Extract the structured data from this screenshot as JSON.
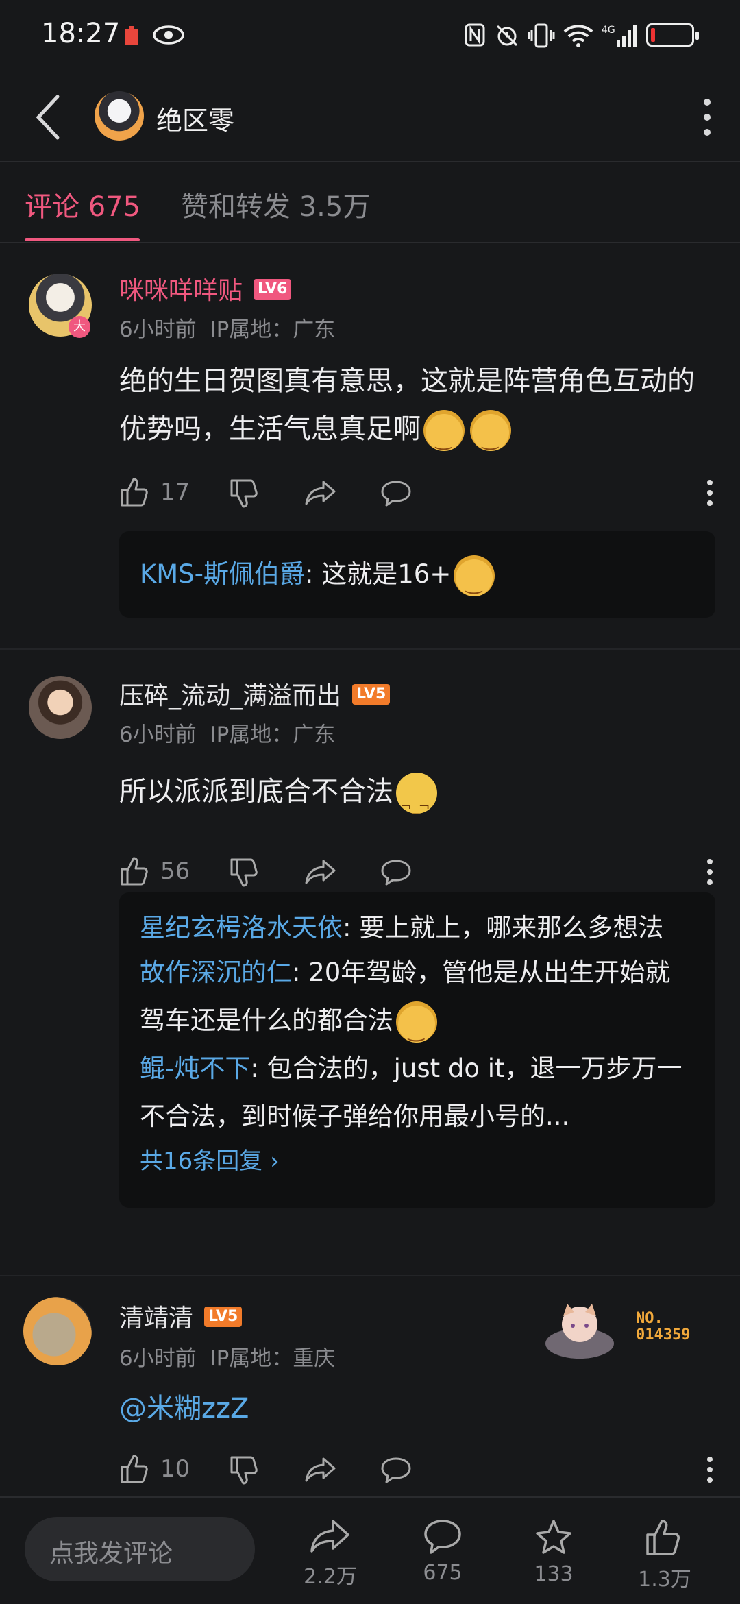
{
  "status": {
    "time": "18:27"
  },
  "header": {
    "title": "绝区零"
  },
  "tabs": [
    {
      "label": "评论 675"
    },
    {
      "label": "赞和转发 3.5万"
    }
  ],
  "comments": [
    {
      "user": "咪咪咩咩贴",
      "level": "LV6",
      "time": "6小时前",
      "ip": "IP属地：广东",
      "text": "绝的生日贺图真有意思，这就是阵营角色互动的优势吗，生活气息真足啊",
      "likes": "17",
      "replies": [
        {
          "who": "KMS-斯佩伯爵",
          "text": ": 这就是16+"
        }
      ]
    },
    {
      "user": "压碎_流动_满溢而出",
      "level": "LV5",
      "time": "6小时前",
      "ip": "IP属地：广东",
      "text": "所以派派到底合不合法",
      "likes": "56",
      "replies": [
        {
          "who": "星纪玄枵洛水天依",
          "text": ": 要上就上，哪来那么多想法"
        },
        {
          "who": "故作深沉的仁",
          "text": ": 20年驾龄，管他是从出生开始就驾车还是什么的都合法"
        },
        {
          "who": "鲲-炖不下",
          "text": ": 包合法的，just do it，退一万步万一不合法，到时候子弹给你用最小号的..."
        }
      ],
      "reply_count": "共16条回复 ›"
    },
    {
      "user": "清靖清",
      "level": "LV5",
      "time": "6小时前",
      "ip": "IP属地：重庆",
      "text": "@米糊zzZ",
      "likes": "10",
      "badge_no": "NO.\n014359"
    }
  ],
  "bottom": {
    "input_placeholder": "点我发评论",
    "share": "2.2万",
    "comment": "675",
    "favorite": "133",
    "like": "1.3万"
  },
  "colors": {
    "accent": "#f0587f",
    "link": "#5aa9e6",
    "bg": "#17181a"
  }
}
